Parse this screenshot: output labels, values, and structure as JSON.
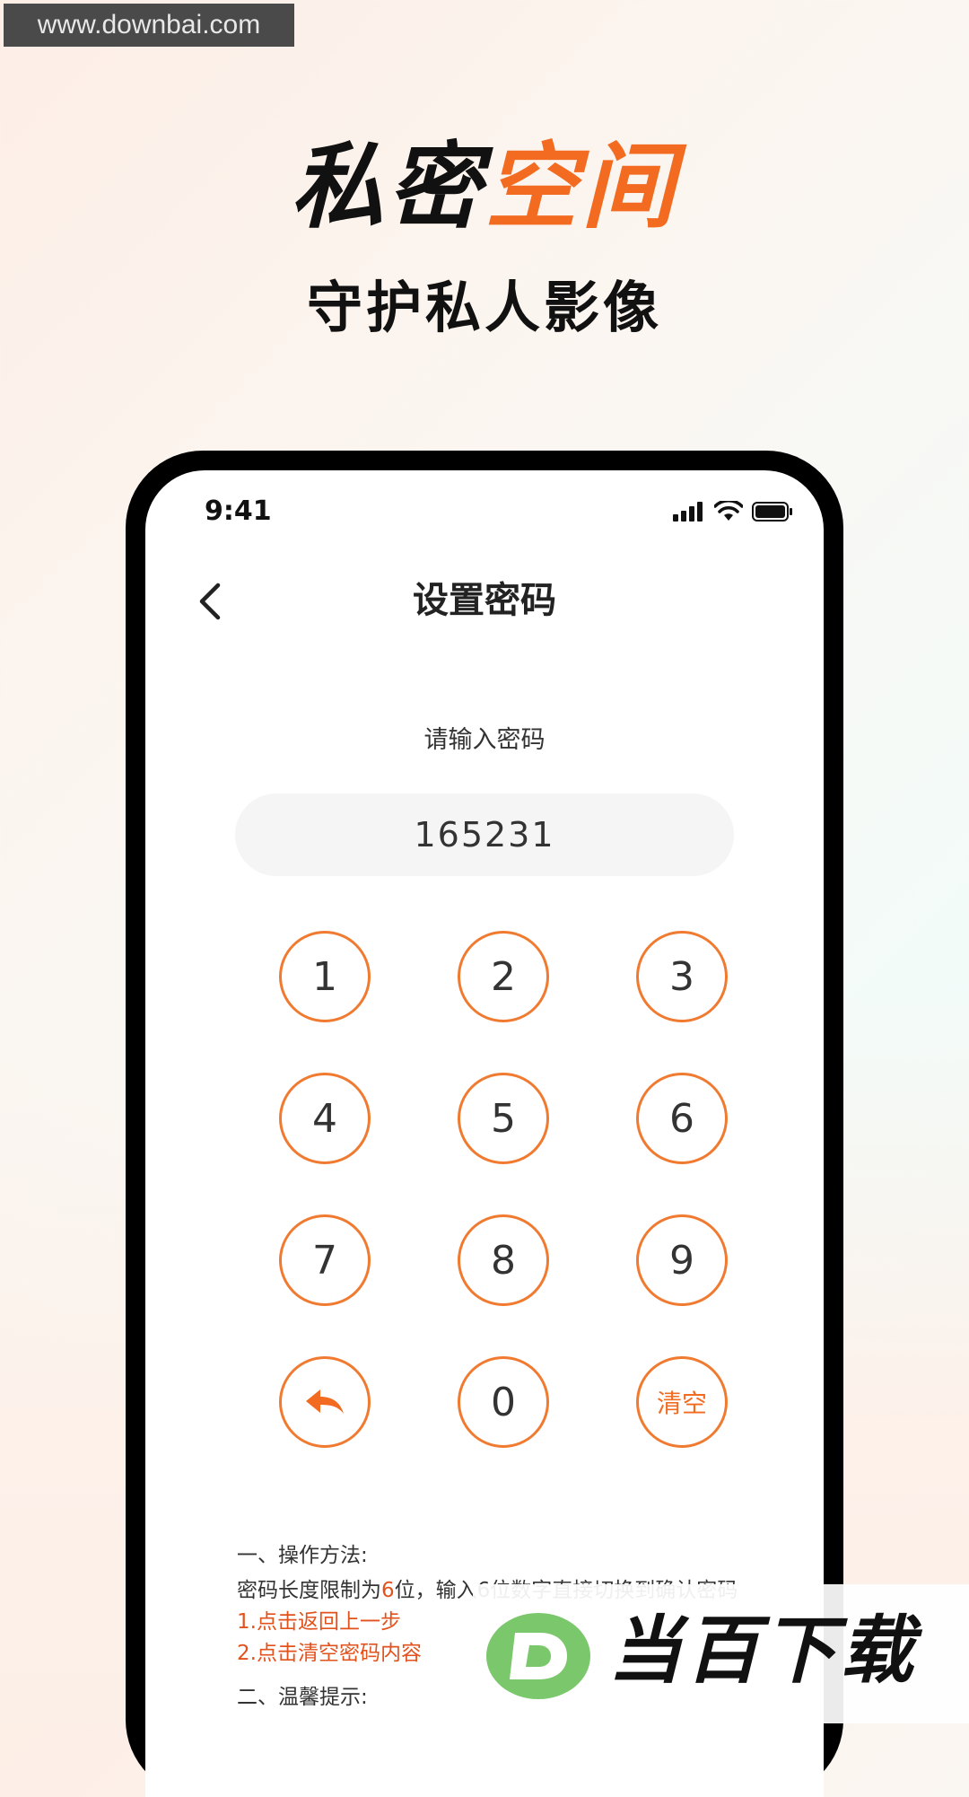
{
  "watermark": {
    "site": "www.downbai.com",
    "brand": "当百下载"
  },
  "hero": {
    "title_dark": "私密",
    "title_accent": "空间",
    "subtitle": "守护私人影像"
  },
  "status_bar": {
    "time": "9:41"
  },
  "nav": {
    "title": "设置密码"
  },
  "pin": {
    "prompt": "请输入密码",
    "value": "165231"
  },
  "keypad": {
    "k1": "1",
    "k2": "2",
    "k3": "3",
    "k4": "4",
    "k5": "5",
    "k6": "6",
    "k7": "7",
    "k8": "8",
    "k9": "9",
    "k0": "0",
    "clear": "清空"
  },
  "tips": {
    "section1_title": "一、操作方法:",
    "line1_prefix": "密码长度限制为",
    "line1_num": "6",
    "line1_suffix": "位，输入6位数字直接切换到确认密码",
    "step1": "1.点击返回上一步",
    "step2": "2.点击清空密码内容",
    "section2_title": "二、温馨提示:"
  },
  "colors": {
    "accent": "#f26b21",
    "ring": "#f07a30",
    "logo_green": "#7bc86c"
  }
}
